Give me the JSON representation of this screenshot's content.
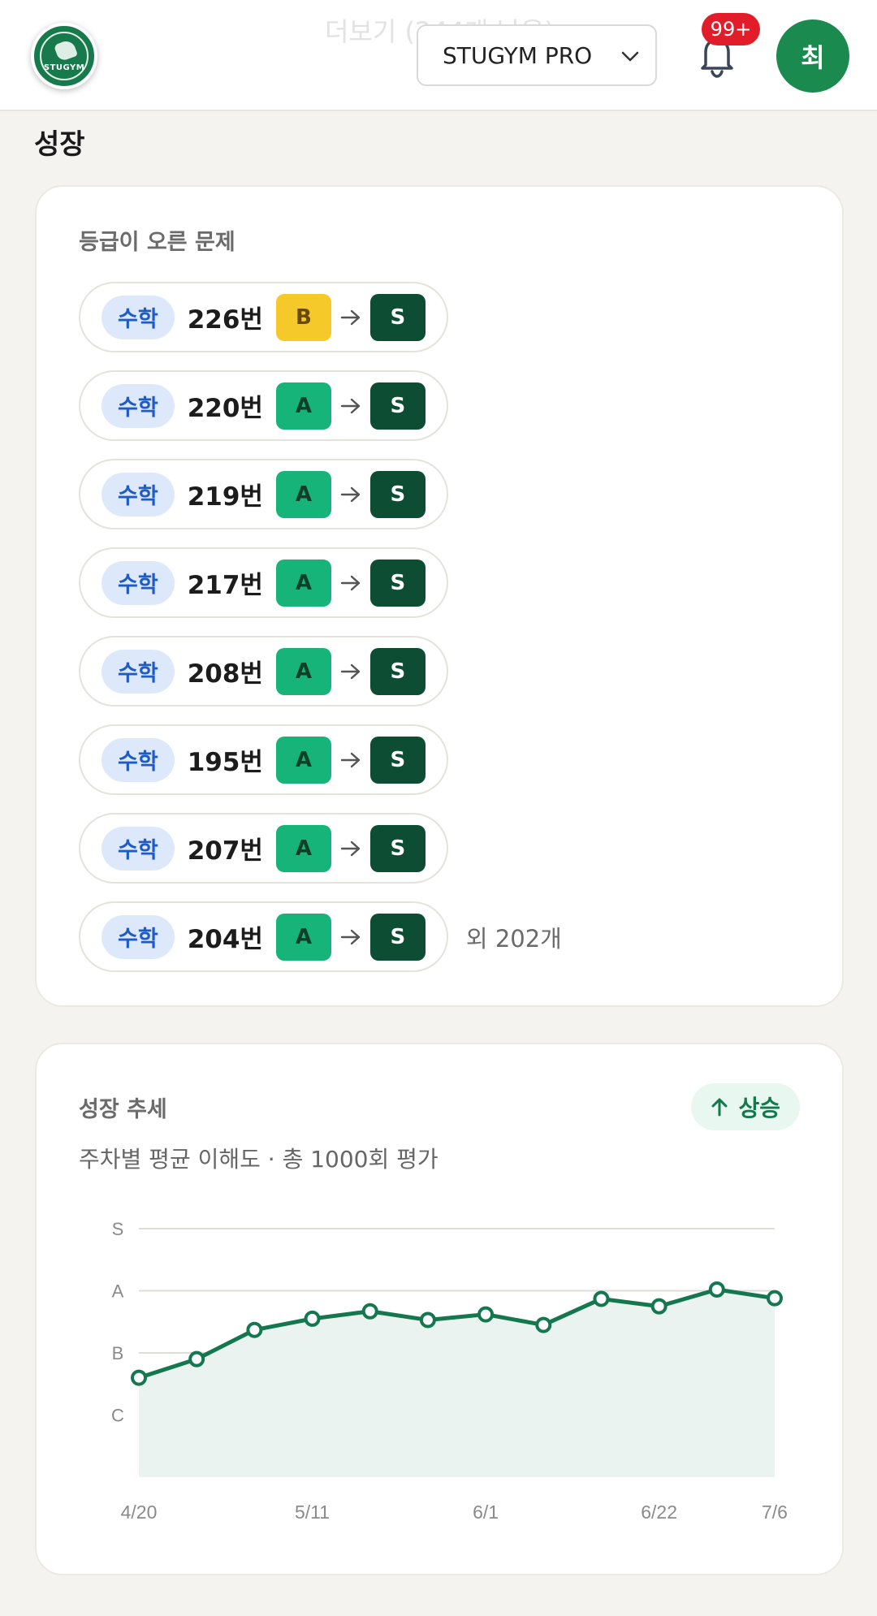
{
  "header": {
    "ghost_text": "더보기 (244개 남음)",
    "logo_text": "STUGYM",
    "plan_select": {
      "selected": "STUGYM PRO"
    },
    "notification_count": "99+",
    "avatar_initial": "최"
  },
  "section_title": "성장",
  "grade_up": {
    "title": "등급이 오른 문제",
    "items": [
      {
        "subject": "수학",
        "problem": "226번",
        "from": "B",
        "to": "S"
      },
      {
        "subject": "수학",
        "problem": "220번",
        "from": "A",
        "to": "S"
      },
      {
        "subject": "수학",
        "problem": "219번",
        "from": "A",
        "to": "S"
      },
      {
        "subject": "수학",
        "problem": "217번",
        "from": "A",
        "to": "S"
      },
      {
        "subject": "수학",
        "problem": "208번",
        "from": "A",
        "to": "S"
      },
      {
        "subject": "수학",
        "problem": "195번",
        "from": "A",
        "to": "S"
      },
      {
        "subject": "수학",
        "problem": "207번",
        "from": "A",
        "to": "S"
      },
      {
        "subject": "수학",
        "problem": "204번",
        "from": "A",
        "to": "S"
      }
    ],
    "more_text": "외 202개"
  },
  "trend": {
    "title": "성장 추세",
    "badge": "상승",
    "subtitle": "주차별 평균 이해도 · 총 1000회 평가"
  },
  "chart_data": {
    "type": "area",
    "y_categories": [
      "C",
      "B",
      "A",
      "S"
    ],
    "ylim": [
      0,
      4
    ],
    "x": [
      "4/20",
      "4/27",
      "5/4",
      "5/11",
      "5/18",
      "5/25",
      "6/1",
      "6/8",
      "6/15",
      "6/22",
      "6/29",
      "7/6"
    ],
    "x_tick_labels": [
      "4/20",
      "5/11",
      "6/1",
      "6/22",
      "7/6"
    ],
    "values": [
      1.6,
      1.9,
      2.37,
      2.55,
      2.67,
      2.53,
      2.62,
      2.45,
      2.87,
      2.75,
      3.02,
      2.88
    ],
    "grid": true,
    "colors": {
      "line": "#14774f",
      "fill": "#eaf3f0",
      "grid": "#deded6"
    }
  }
}
